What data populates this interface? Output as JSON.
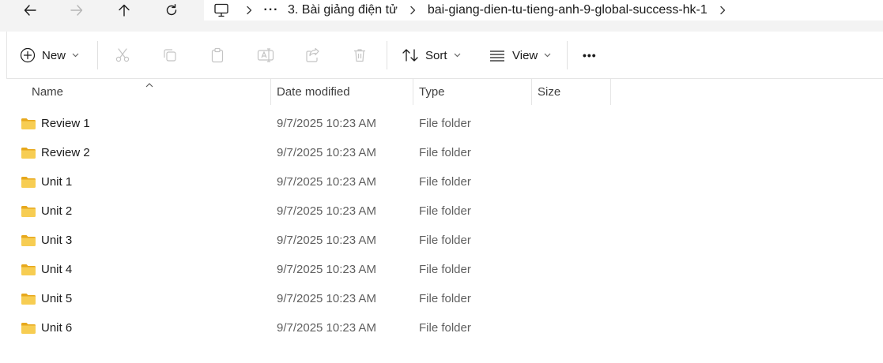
{
  "breadcrumb": {
    "items": [
      "3. Bài giảng điện tử",
      "bai-giang-dien-tu-tieng-anh-9-global-success-hk-1"
    ],
    "overflow": "···"
  },
  "toolbar": {
    "new_label": "New",
    "sort_label": "Sort",
    "view_label": "View",
    "more_label": "•••"
  },
  "columns": {
    "name": "Name",
    "date": "Date modified",
    "type": "Type",
    "size": "Size"
  },
  "rows": [
    {
      "name": "Review 1",
      "date": "9/7/2025 10:23 AM",
      "type": "File folder"
    },
    {
      "name": "Review 2",
      "date": "9/7/2025 10:23 AM",
      "type": "File folder"
    },
    {
      "name": "Unit 1",
      "date": "9/7/2025 10:23 AM",
      "type": "File folder"
    },
    {
      "name": "Unit 2",
      "date": "9/7/2025 10:23 AM",
      "type": "File folder"
    },
    {
      "name": "Unit 3",
      "date": "9/7/2025 10:23 AM",
      "type": "File folder"
    },
    {
      "name": "Unit 4",
      "date": "9/7/2025 10:23 AM",
      "type": "File folder"
    },
    {
      "name": "Unit 5",
      "date": "9/7/2025 10:23 AM",
      "type": "File folder"
    },
    {
      "name": "Unit 6",
      "date": "9/7/2025 10:23 AM",
      "type": "File folder"
    }
  ],
  "icons": {
    "back": "back-arrow-icon",
    "forward": "forward-arrow-icon",
    "up": "up-arrow-icon",
    "refresh": "refresh-icon",
    "pc": "this-pc-icon",
    "folder": "folder-icon"
  },
  "colors": {
    "folder": "#f4c542",
    "accent": "#005fb8"
  }
}
